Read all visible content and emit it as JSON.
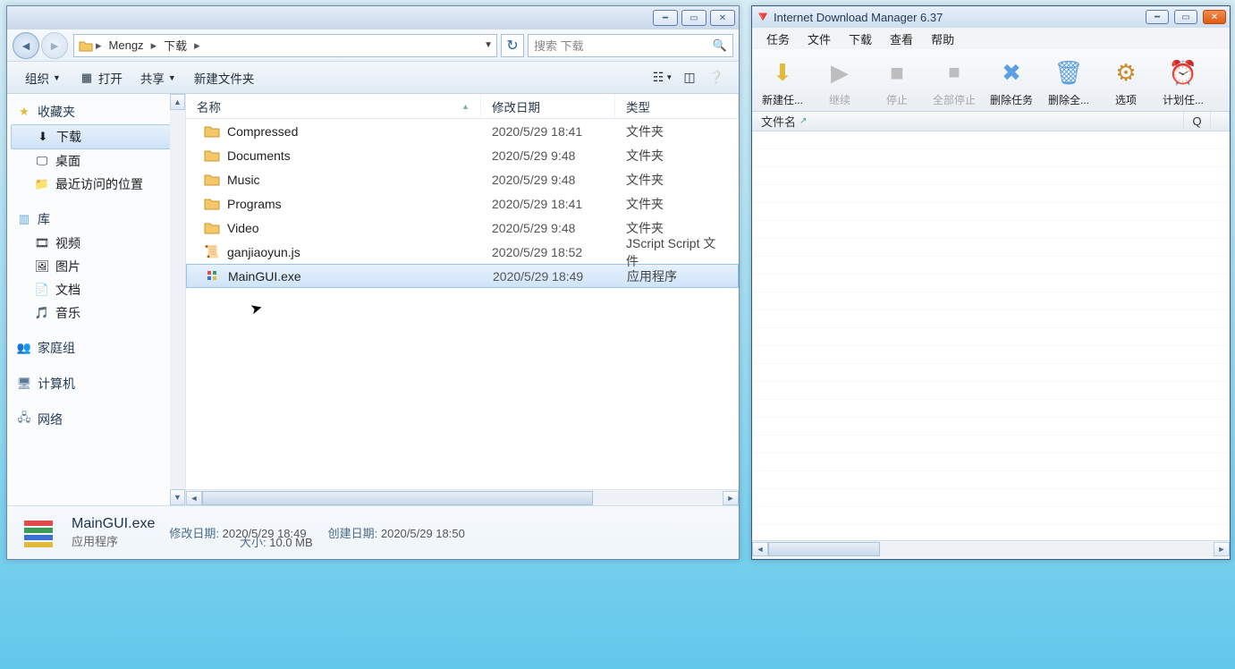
{
  "explorer": {
    "breadcrumbs": [
      "Mengz",
      "下载"
    ],
    "search_placeholder": "搜索 下载",
    "toolbar": {
      "organize": "组织",
      "open": "打开",
      "share": "共享",
      "new_folder": "新建文件夹"
    },
    "columns": {
      "name": "名称",
      "date": "修改日期",
      "type": "类型"
    },
    "sidebar": {
      "favorites": {
        "label": "收藏夹",
        "items": [
          {
            "icon": "download",
            "label": "下载",
            "selected": true
          },
          {
            "icon": "desktop",
            "label": "桌面"
          },
          {
            "icon": "recent",
            "label": "最近访问的位置"
          }
        ]
      },
      "libraries": {
        "label": "库",
        "items": [
          {
            "icon": "video",
            "label": "视频"
          },
          {
            "icon": "picture",
            "label": "图片"
          },
          {
            "icon": "doc",
            "label": "文档"
          },
          {
            "icon": "music",
            "label": "音乐"
          }
        ]
      },
      "homegroup": {
        "label": "家庭组"
      },
      "computer": {
        "label": "计算机"
      },
      "network": {
        "label": "网络"
      }
    },
    "files": [
      {
        "icon": "folder",
        "name": "Compressed",
        "date": "2020/5/29 18:41",
        "type": "文件夹"
      },
      {
        "icon": "folder",
        "name": "Documents",
        "date": "2020/5/29 9:48",
        "type": "文件夹"
      },
      {
        "icon": "folder",
        "name": "Music",
        "date": "2020/5/29 9:48",
        "type": "文件夹"
      },
      {
        "icon": "folder",
        "name": "Programs",
        "date": "2020/5/29 18:41",
        "type": "文件夹"
      },
      {
        "icon": "folder",
        "name": "Video",
        "date": "2020/5/29 9:48",
        "type": "文件夹"
      },
      {
        "icon": "js",
        "name": "ganjiaoyun.js",
        "date": "2020/5/29 18:52",
        "type": "JScript Script 文件"
      },
      {
        "icon": "exe",
        "name": "MainGUI.exe",
        "date": "2020/5/29 18:49",
        "type": "应用程序",
        "selected": true
      }
    ],
    "details": {
      "name": "MainGUI.exe",
      "subtype": "应用程序",
      "mod_label": "修改日期:",
      "mod_value": "2020/5/29 18:49",
      "created_label": "创建日期:",
      "created_value": "2020/5/29 18:50",
      "size_label": "大小:",
      "size_value": "10.0 MB"
    }
  },
  "idm": {
    "title": "Internet Download Manager 6.37",
    "menu": [
      "任务",
      "文件",
      "下载",
      "查看",
      "帮助"
    ],
    "toolbar": [
      {
        "label": "新建任...",
        "color": "#e2b93b"
      },
      {
        "label": "继续",
        "disabled": true,
        "color": "#bdbdbd"
      },
      {
        "label": "停止",
        "disabled": true,
        "color": "#bdbdbd"
      },
      {
        "label": "全部停止",
        "disabled": true,
        "color": "#bdbdbd"
      },
      {
        "label": "删除任务",
        "color": "#5a9fe0"
      },
      {
        "label": "删除全...",
        "color": "#5a9fe0"
      },
      {
        "label": "选项",
        "color": "#c98b2e"
      },
      {
        "label": "计划任...",
        "color": "#e2a93b"
      }
    ],
    "columns": {
      "filename": "文件名",
      "q": "Q"
    }
  }
}
